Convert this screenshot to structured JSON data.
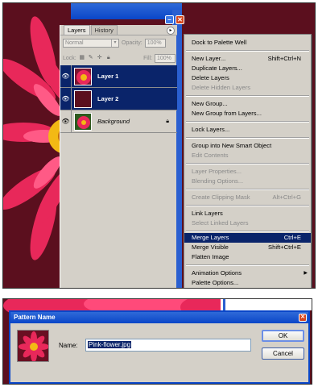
{
  "palette": {
    "tabs": [
      "Layers",
      "History"
    ],
    "blend_mode": "Normal",
    "opacity_label": "Opacity:",
    "opacity_value": "100%",
    "lock_label": "Lock:",
    "fill_label": "Fill:",
    "fill_value": "100%",
    "layers": [
      {
        "name": "Layer 1",
        "selected": true
      },
      {
        "name": "Layer 2",
        "selected": true
      },
      {
        "name": "Background",
        "selected": false
      }
    ]
  },
  "menu": {
    "items": [
      {
        "label": "Dock to Palette Well",
        "shortcut": "",
        "disabled": false
      },
      {
        "label": "New Layer...",
        "shortcut": "Shift+Ctrl+N",
        "disabled": false
      },
      {
        "label": "Duplicate Layers...",
        "shortcut": "",
        "disabled": false
      },
      {
        "label": "Delete Layers",
        "shortcut": "",
        "disabled": false
      },
      {
        "label": "Delete Hidden Layers",
        "shortcut": "",
        "disabled": true
      },
      {
        "label": "New Group...",
        "shortcut": "",
        "disabled": false
      },
      {
        "label": "New Group from Layers...",
        "shortcut": "",
        "disabled": false
      },
      {
        "label": "Lock Layers...",
        "shortcut": "",
        "disabled": false
      },
      {
        "label": "Group into New Smart Object",
        "shortcut": "",
        "disabled": false
      },
      {
        "label": "Edit Contents",
        "shortcut": "",
        "disabled": true
      },
      {
        "label": "Layer Properties...",
        "shortcut": "",
        "disabled": true
      },
      {
        "label": "Blending Options...",
        "shortcut": "",
        "disabled": true
      },
      {
        "label": "Create Clipping Mask",
        "shortcut": "Alt+Ctrl+G",
        "disabled": true
      },
      {
        "label": "Link Layers",
        "shortcut": "",
        "disabled": false
      },
      {
        "label": "Select Linked Layers",
        "shortcut": "",
        "disabled": true
      },
      {
        "label": "Merge Layers",
        "shortcut": "Ctrl+E",
        "disabled": false,
        "highlighted": true
      },
      {
        "label": "Merge Visible",
        "shortcut": "Shift+Ctrl+E",
        "disabled": false
      },
      {
        "label": "Flatten Image",
        "shortcut": "",
        "disabled": false
      },
      {
        "label": "Animation Options",
        "shortcut": "",
        "disabled": false,
        "submenu": true
      },
      {
        "label": "Palette Options...",
        "shortcut": "",
        "disabled": false
      }
    ]
  },
  "dialog": {
    "title": "Pattern Name",
    "name_label": "Name:",
    "name_value": "Pink-flower.jpg",
    "ok_label": "OK",
    "cancel_label": "Cancel"
  },
  "icons": {
    "eye": "eye-icon",
    "lock": "lock-icon",
    "brush": "brush-icon",
    "move": "move-icon",
    "minimize": "minimize-icon",
    "close": "close-icon",
    "arrow_right": "submenu-arrow-icon"
  },
  "colors": {
    "highlight": "#0a246a",
    "panel": "#d4d0c8",
    "titlebar": "#0a46c8"
  }
}
